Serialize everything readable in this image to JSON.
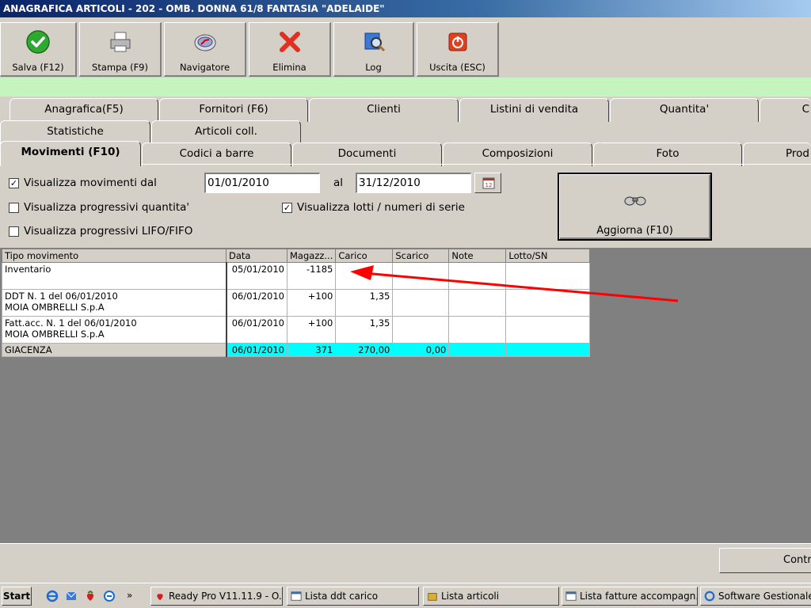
{
  "window": {
    "title": "ANAGRAFICA ARTICOLI - 202 - OMB. DONNA 61/8 FANTASIA \"ADELAIDE\""
  },
  "toolbar": {
    "save": "Salva (F12)",
    "print": "Stampa (F9)",
    "navigator": "Navigatore",
    "delete": "Elimina",
    "log": "Log",
    "exit": "Uscita (ESC)"
  },
  "tabs": {
    "row1": [
      "Anagrafica(F5)",
      "Fornitori (F6)",
      "Clienti",
      "Listini di vendita",
      "Quantita'",
      "C"
    ],
    "row2": [
      "Statistiche",
      "Articoli coll."
    ],
    "row3": [
      "Movimenti (F10)",
      "Codici a barre",
      "Documenti",
      "Composizioni",
      "Foto",
      "Prod"
    ]
  },
  "filters": {
    "show_movements_label": "Visualizza movimenti dal",
    "show_movements_checked": true,
    "date_from": "01/01/2010",
    "al_label": "al",
    "date_to": "31/12/2010",
    "show_progressive_qty_label": "Visualizza progressivi quantita'",
    "show_progressive_qty_checked": false,
    "show_lifo_fifo_label": "Visualizza progressivi LIFO/FIFO",
    "show_lifo_fifo_checked": false,
    "show_lots_label": "Visualizza lotti / numeri di serie",
    "show_lots_checked": true,
    "refresh_label": "Aggiorna (F10)"
  },
  "grid": {
    "columns": [
      "Tipo movimento",
      "Data",
      "Magazz...",
      "Carico",
      "Scarico",
      "Note",
      "Lotto/SN"
    ],
    "rows": [
      {
        "type_line1": "Inventario",
        "type_line2": "",
        "data": "05/01/2010",
        "magazz": "-1185",
        "carico": "",
        "scarico": "",
        "note": "",
        "lotto": ""
      },
      {
        "type_line1": "DDT N. 1 del 06/01/2010",
        "type_line2": "MOIA OMBRELLI S.p.A",
        "data": "06/01/2010",
        "magazz": "+100",
        "carico": "1,35",
        "scarico": "",
        "note": "",
        "lotto": ""
      },
      {
        "type_line1": "Fatt.acc. N. 1 del 06/01/2010",
        "type_line2": "MOIA OMBRELLI S.p.A",
        "data": "06/01/2010",
        "magazz": "+100",
        "carico": "1,35",
        "scarico": "",
        "note": "",
        "lotto": ""
      }
    ],
    "total": {
      "type": "GIACENZA",
      "data": "06/01/2010",
      "magazz": "371",
      "carico": "270,00",
      "scarico": "0,00",
      "note": "",
      "lotto": ""
    }
  },
  "bottom": {
    "button_label": "Contr"
  },
  "taskbar": {
    "start": "Start",
    "tasks": [
      "Ready Pro V11.11.9 - O...",
      "Lista ddt carico",
      "Lista articoli",
      "Lista fatture accompagn...",
      "Software Gestionale Re"
    ]
  },
  "colors": {
    "accent": "#0a246a",
    "annotation_arrow": "#ff0000",
    "total_row": "#00ffff",
    "green_strip": "#c6f4bf"
  }
}
